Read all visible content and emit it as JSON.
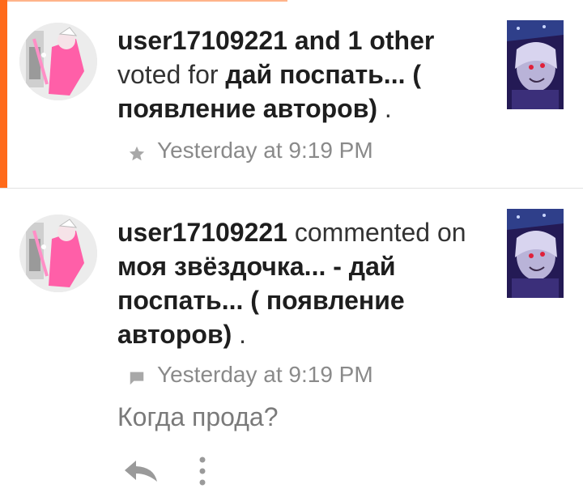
{
  "notifications": [
    {
      "actor": "user17109221 and 1 other",
      "action": " voted for ",
      "target": "дай поспать... ( появление авторов)",
      "suffix": " .",
      "timestamp": "Yesterday at 9:19 PM",
      "meta_icon": "star-icon",
      "unread": true
    },
    {
      "actor": "user17109221",
      "action": " commented on ",
      "target": "моя звёздочка... - дай поспать... ( появление авторов)",
      "suffix": " .",
      "timestamp": "Yesterday at 9:19 PM",
      "meta_icon": "comment-icon",
      "comment": "Когда прода?",
      "actions": [
        "reply-icon",
        "more-vertical-icon"
      ]
    }
  ],
  "colors": {
    "unread_accent": "#ff6a1a",
    "meta_text": "#8a8a8a",
    "body_text": "#333333",
    "thumbnail_bg": "#241a55"
  }
}
